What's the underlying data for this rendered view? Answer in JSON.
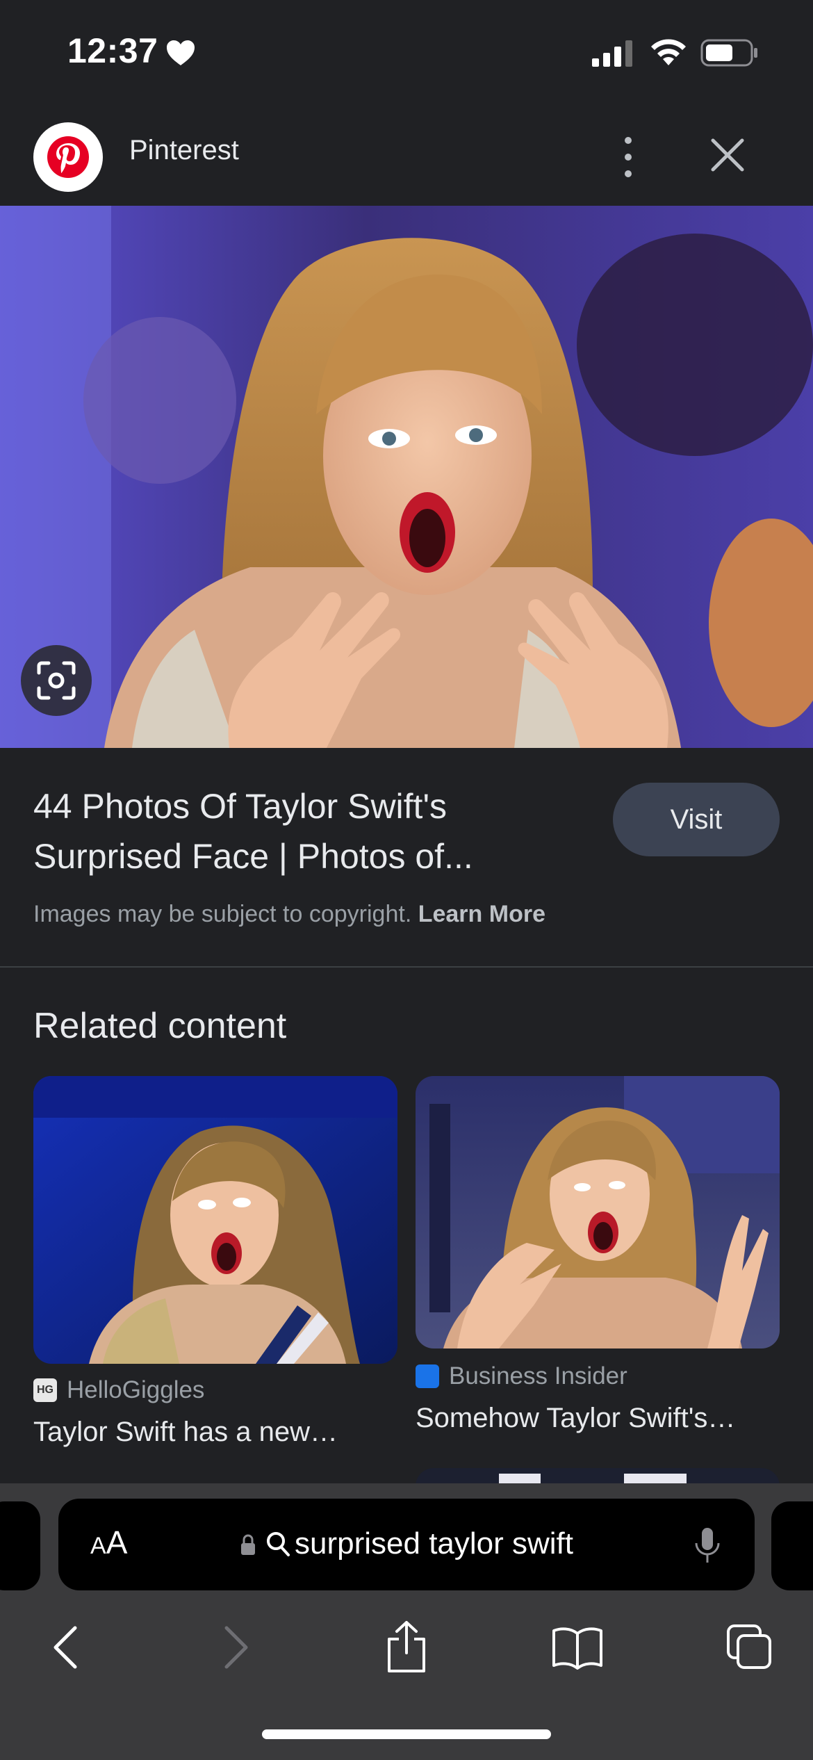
{
  "status_bar": {
    "time": "12:37"
  },
  "source": {
    "name": "Pinterest"
  },
  "result": {
    "title_line1": "44 Photos Of Taylor Swift's",
    "title_line2": "Surprised Face | Photos of...",
    "visit_label": "Visit",
    "copyright_text": "Images may be subject to copyright.",
    "learn_more_label": "Learn More"
  },
  "related": {
    "heading": "Related content",
    "cards": [
      {
        "source": "HelloGiggles",
        "favicon_text": "HG",
        "title": "Taylor Swift has a new…"
      },
      {
        "source": "Business Insider",
        "favicon_text": "",
        "title": "Somehow Taylor Swift's…"
      }
    ]
  },
  "browser": {
    "text_size_label": "AA",
    "address_text": "surprised taylor swift"
  },
  "colors": {
    "background": "#202124",
    "visit_button": "#3c4353",
    "pinterest_red": "#e60023",
    "business_insider_blue": "#1a73e8"
  }
}
